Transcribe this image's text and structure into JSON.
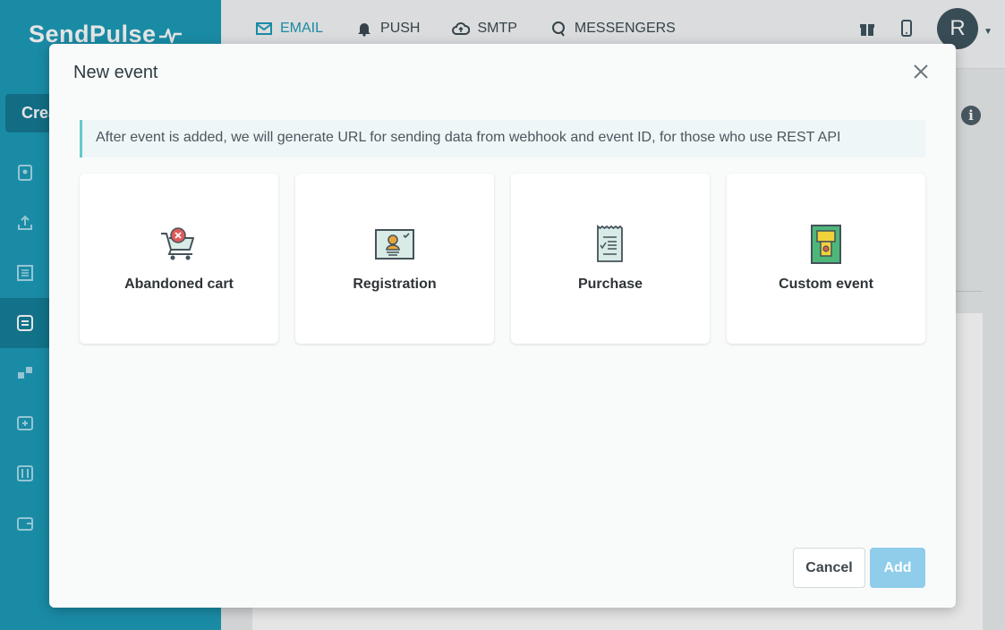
{
  "app": {
    "logo_text": "SendPulse",
    "create_label": "Crea"
  },
  "topnav": [
    {
      "label": "EMAIL",
      "icon": "envelope-icon",
      "active": true
    },
    {
      "label": "PUSH",
      "icon": "bell-icon",
      "active": false
    },
    {
      "label": "SMTP",
      "icon": "cloud-upload-icon",
      "active": false
    },
    {
      "label": "MESSENGERS",
      "icon": "chat-bubble-icon",
      "active": false
    }
  ],
  "user": {
    "avatar_letter": "R"
  },
  "sidebar": {
    "icons": [
      "address-book-icon",
      "upload-icon",
      "forms-icon",
      "automation-icon",
      "integrations-icon",
      "templates-icon",
      "settings-icon",
      "wallet-icon"
    ],
    "active_index": 3
  },
  "modal": {
    "title": "New event",
    "info_text": "After event is added, we will generate URL for sending data from webhook and event ID, for those who use REST API",
    "cards": [
      {
        "label": "Abandoned cart",
        "icon": "shopping-cart-icon"
      },
      {
        "label": "Registration",
        "icon": "registration-card-icon"
      },
      {
        "label": "Purchase",
        "icon": "receipt-icon"
      },
      {
        "label": "Custom event",
        "icon": "custom-device-icon"
      }
    ],
    "cancel_label": "Cancel",
    "add_label": "Add"
  },
  "colors": {
    "brand": "#1e9bb8",
    "add_button_disabled": "#8fcdea",
    "info_accent": "#66c8c8"
  }
}
